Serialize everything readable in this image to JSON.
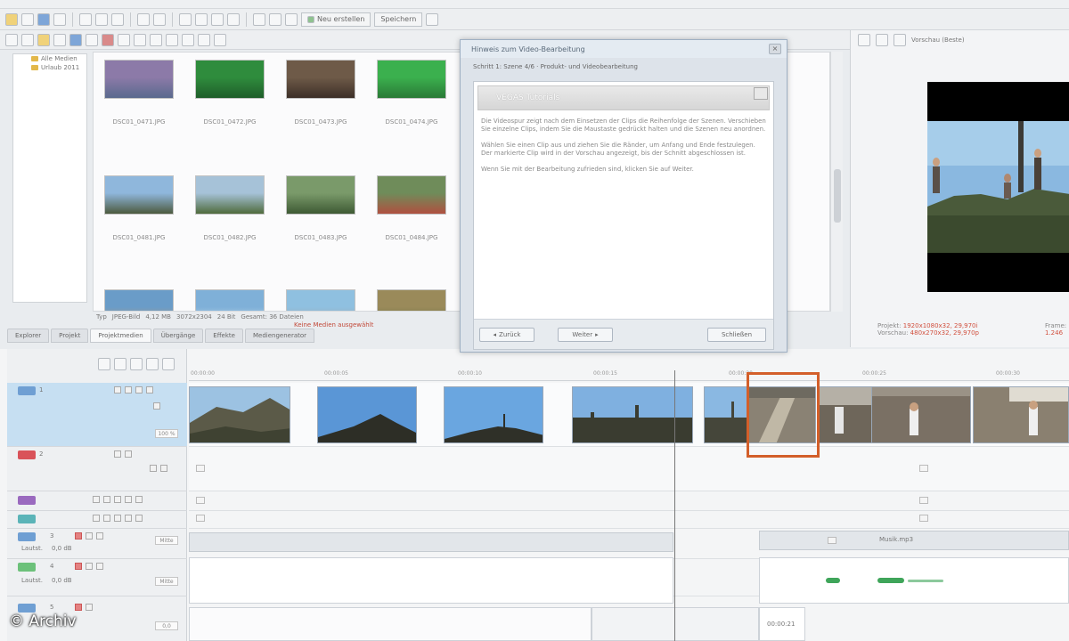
{
  "dialog": {
    "title": "Hinweis zum Video-Bearbeitung",
    "close": "×",
    "subtitle": "Schritt 1: Szene 4/6 · Produkt- und Videobearbeitung",
    "header": "VEGAS Tutorials",
    "paragraphs": [
      "Die Videospur zeigt nach dem Einsetzen der Clips die Reihenfolge der Szenen. Verschieben Sie einzelne Clips, indem Sie die Maustaste gedrückt halten und die Szenen neu anordnen.",
      "Wählen Sie einen Clip aus und ziehen Sie die Ränder, um Anfang und Ende festzulegen. Der markierte Clip wird in der Vorschau angezeigt, bis der Schnitt abgeschlossen ist.",
      "Wenn Sie mit der Bearbeitung zufrieden sind, klicken Sie auf Weiter."
    ],
    "buttons": {
      "back": "Zurück",
      "next": "Weiter",
      "close": "Schließen"
    }
  },
  "media": {
    "items": [
      {
        "caption": "DSC01_0471.JPG",
        "colors": [
          "#8c7aa8",
          "#5a6a8e"
        ]
      },
      {
        "caption": "DSC01_0472.JPG",
        "colors": [
          "#2f8c3d",
          "#1f5e2a"
        ]
      },
      {
        "caption": "DSC01_0473.JPG",
        "colors": [
          "#6e5a48",
          "#3d3028"
        ]
      },
      {
        "caption": "DSC01_0474.JPG",
        "colors": [
          "#3bb04e",
          "#2a7a36"
        ]
      },
      {
        "caption": "DSC01_0481.JPG",
        "colors": [
          "#8fb7dc",
          "#4c5a3e"
        ]
      },
      {
        "caption": "DSC01_0482.JPG",
        "colors": [
          "#a6c2d8",
          "#4f6b3c"
        ]
      },
      {
        "caption": "DSC01_0483.JPG",
        "colors": [
          "#7a9a6a",
          "#3e5a34"
        ]
      },
      {
        "caption": "DSC01_0484.JPG",
        "colors": [
          "#6f8c5a",
          "#b05040"
        ]
      },
      {
        "caption": "",
        "colors": [
          "#6a9cc8",
          "#c6a070"
        ]
      },
      {
        "caption": "",
        "colors": [
          "#7fb0d8",
          "#cfe0ec"
        ]
      },
      {
        "caption": "",
        "colors": [
          "#8fc0e0",
          "#a0a0a0"
        ]
      },
      {
        "caption": "",
        "colors": [
          "#9a8a5a",
          "#5a6a3a"
        ]
      }
    ]
  },
  "infobar": [
    "Typ",
    "JPEG-Bild",
    "4,12 MB",
    "3072x2304",
    "24 Bit",
    "Gesamt: 36 Dateien"
  ],
  "statusline": "Keine Medien ausgewählt",
  "tabs": [
    "Explorer",
    "Projekt",
    "Projektmedien",
    "Übergänge",
    "Effekte",
    "Mediengenerator"
  ],
  "toolbar": {
    "new": "Neu erstellen",
    "save": "Speichern"
  },
  "tree": [
    "Alle Medien",
    "Urlaub 2011"
  ],
  "preview": {
    "title": "Vorschau (Beste)",
    "project_label": "Projekt:",
    "project_value": "1920x1080x32, 29,970i",
    "frame_label": "Frame:",
    "frame_value": "1.246",
    "preview_label": "Vorschau:",
    "preview_value": "480x270x32, 29,970p"
  },
  "ruler": [
    "00:00:00",
    "00:00:05",
    "00:00:10",
    "00:00:15",
    "00:00:20",
    "00:00:25",
    "00:00:30"
  ],
  "tracks": {
    "video": {
      "number": "1",
      "level": "100 %"
    },
    "overlay": {
      "number": "2"
    },
    "audio1": {
      "number": "3",
      "label": "Lautst.",
      "value": "0,0 dB",
      "pan": "Mitte"
    },
    "audio2": {
      "number": "4",
      "label": "Lautst.",
      "value": "0,0 dB",
      "pan": "Mitte"
    },
    "master": {
      "number": "5",
      "value": "0,0"
    }
  },
  "audio_clip_label": "Musik.mp3",
  "timecode_box": "00:00:21",
  "watermark": "© Archiv",
  "colors": {
    "selection": "#d35f2a",
    "video_track": "#c6dff2",
    "waveform": "#3fa55a"
  }
}
